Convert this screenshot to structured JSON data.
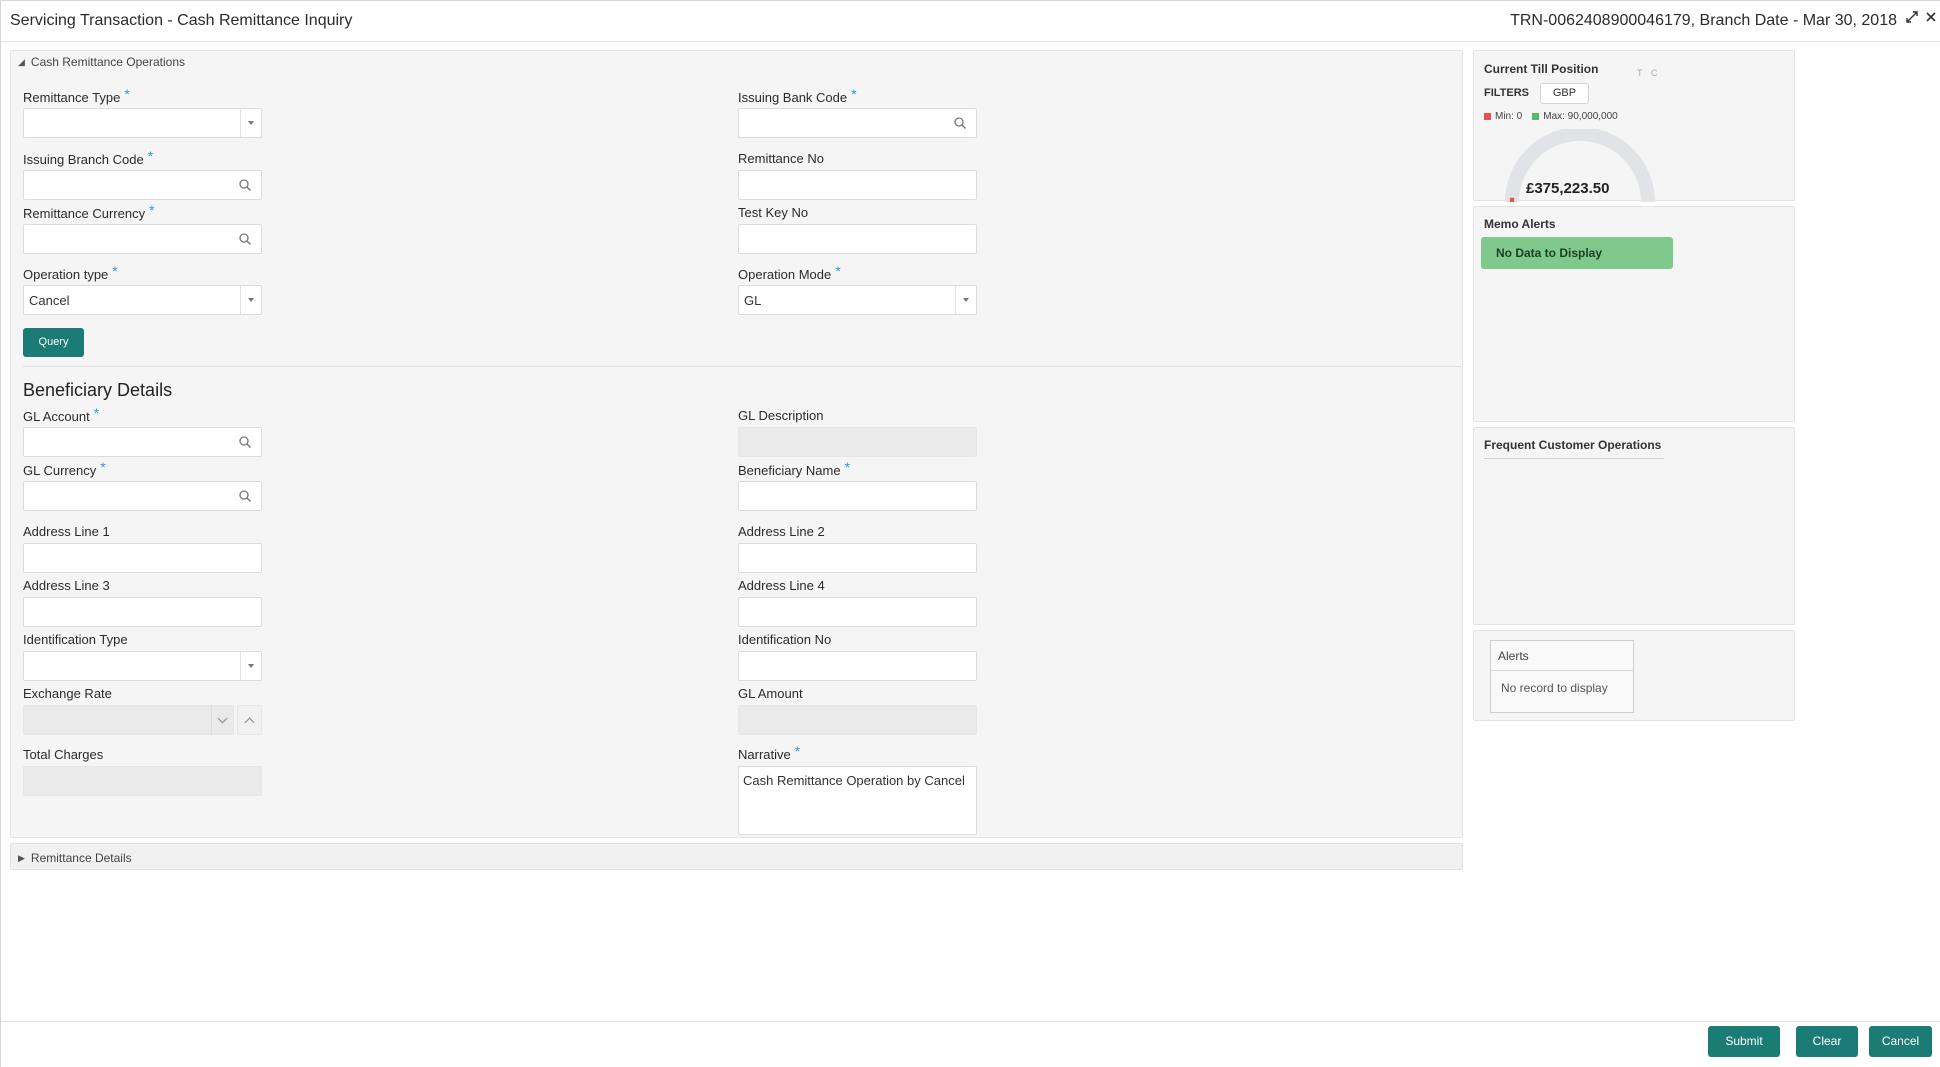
{
  "header": {
    "title": "Servicing Transaction - Cash Remittance Inquiry",
    "reference": "TRN-0062408900046179, Branch Date - Mar 30, 2018"
  },
  "section_ops": {
    "title": "Cash Remittance Operations",
    "fields": {
      "remittance_type": {
        "label": "Remittance Type",
        "value": ""
      },
      "issuing_bank_code": {
        "label": "Issuing Bank Code",
        "value": ""
      },
      "issuing_branch_code": {
        "label": "Issuing Branch Code",
        "value": ""
      },
      "remittance_no": {
        "label": "Remittance No",
        "value": ""
      },
      "remittance_currency": {
        "label": "Remittance Currency",
        "value": ""
      },
      "test_key_no": {
        "label": "Test Key No",
        "value": ""
      },
      "operation_type": {
        "label": "Operation type",
        "value": "Cancel"
      },
      "operation_mode": {
        "label": "Operation Mode",
        "value": "GL"
      }
    },
    "query_label": "Query"
  },
  "beneficiary": {
    "title": "Beneficiary Details",
    "fields": {
      "gl_account": {
        "label": "GL Account",
        "value": ""
      },
      "gl_description": {
        "label": "GL Description",
        "value": ""
      },
      "gl_currency": {
        "label": "GL Currency",
        "value": ""
      },
      "beneficiary_name": {
        "label": "Beneficiary Name",
        "value": ""
      },
      "address_line_1": {
        "label": "Address Line 1",
        "value": ""
      },
      "address_line_2": {
        "label": "Address Line 2",
        "value": ""
      },
      "address_line_3": {
        "label": "Address Line 3",
        "value": ""
      },
      "address_line_4": {
        "label": "Address Line 4",
        "value": ""
      },
      "identification_type": {
        "label": "Identification Type",
        "value": ""
      },
      "identification_no": {
        "label": "Identification No",
        "value": ""
      },
      "exchange_rate": {
        "label": "Exchange Rate",
        "value": ""
      },
      "gl_amount": {
        "label": "GL Amount",
        "value": ""
      },
      "total_charges": {
        "label": "Total Charges",
        "value": ""
      },
      "narrative": {
        "label": "Narrative",
        "value": "Cash Remittance Operation by Cancel"
      }
    },
    "required_mark": "*"
  },
  "section_remittance": {
    "title": "Remittance Details"
  },
  "till": {
    "title": "Current Till Position",
    "tc": "T C",
    "filters_label": "FILTERS",
    "currency": "GBP",
    "min_label": "Min: 0",
    "max_label": "Max: 90,000,000",
    "amount": "£375,223.50",
    "min_color": "#e8544b",
    "max_color": "#5bb86b",
    "gauge_fraction": 0.004
  },
  "memo": {
    "title": "Memo Alerts",
    "message": "No Data to Display"
  },
  "frequent": {
    "title": "Frequent Customer Operations"
  },
  "alerts": {
    "title": "Alerts",
    "message": "No record to display"
  },
  "footer": {
    "submit": "Submit",
    "clear": "Clear",
    "cancel": "Cancel"
  },
  "colors": {
    "accent": "#1b7c75",
    "required": "#2e9bd6",
    "memo_bg": "#7ec98b"
  }
}
